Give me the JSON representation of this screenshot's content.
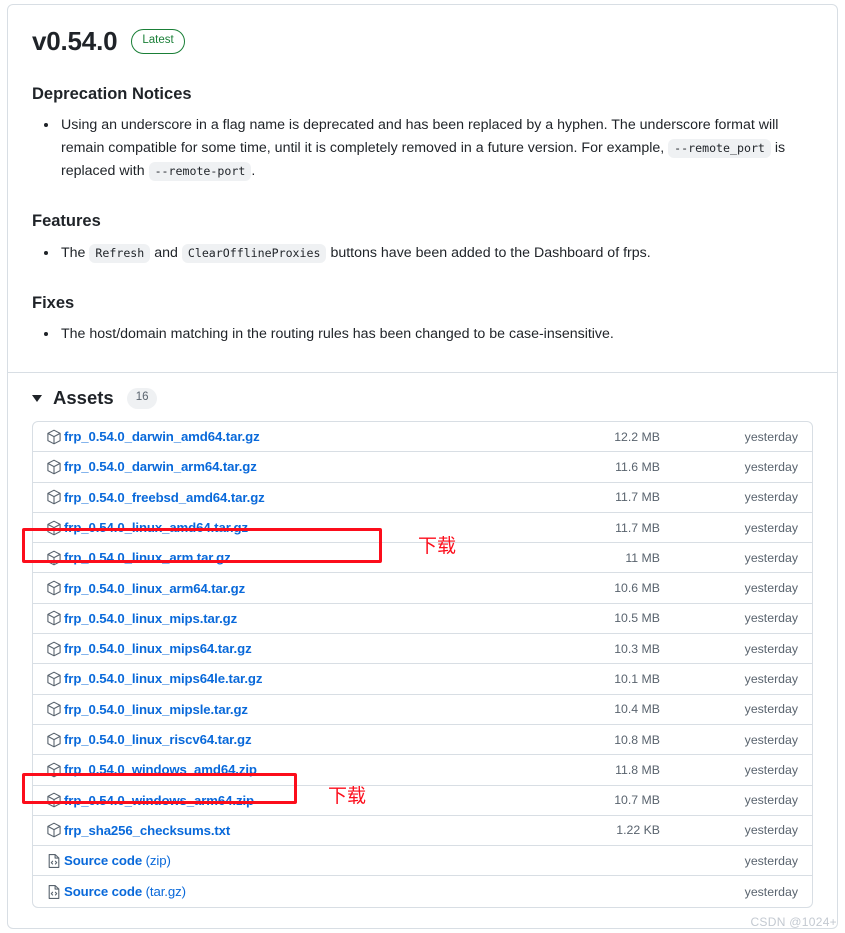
{
  "release": {
    "version": "v0.54.0",
    "latest_badge": "Latest"
  },
  "sections": {
    "deprecation": {
      "heading": "Deprecation Notices",
      "item_part1": "Using an underscore in a flag name is deprecated and has been replaced by a hyphen. The underscore format will remain compatible for some time, until it is completely removed in a future version. For example,",
      "code1": "--remote_port",
      "item_part2": "is replaced with",
      "code2": "--remote-port",
      "item_part3": "."
    },
    "features": {
      "heading": "Features",
      "item_part1": "The",
      "code1": "Refresh",
      "item_part2": "and",
      "code2": "ClearOfflineProxies",
      "item_part3": "buttons have been added to the Dashboard of frps."
    },
    "fixes": {
      "heading": "Fixes",
      "item": "The host/domain matching in the routing rules has been changed to be case-insensitive."
    }
  },
  "assets": {
    "label": "Assets",
    "count": "16",
    "rows": [
      {
        "name": "frp_0.54.0_darwin_amd64.tar.gz",
        "icon": "package-icon",
        "size": "12.2 MB",
        "date": "yesterday"
      },
      {
        "name": "frp_0.54.0_darwin_arm64.tar.gz",
        "icon": "package-icon",
        "size": "11.6 MB",
        "date": "yesterday"
      },
      {
        "name": "frp_0.54.0_freebsd_amd64.tar.gz",
        "icon": "package-icon",
        "size": "11.7 MB",
        "date": "yesterday"
      },
      {
        "name": "frp_0.54.0_linux_amd64.tar.gz",
        "icon": "package-icon",
        "size": "11.7 MB",
        "date": "yesterday"
      },
      {
        "name": "frp_0.54.0_linux_arm.tar.gz",
        "icon": "package-icon",
        "size": "11 MB",
        "date": "yesterday"
      },
      {
        "name": "frp_0.54.0_linux_arm64.tar.gz",
        "icon": "package-icon",
        "size": "10.6 MB",
        "date": "yesterday"
      },
      {
        "name": "frp_0.54.0_linux_mips.tar.gz",
        "icon": "package-icon",
        "size": "10.5 MB",
        "date": "yesterday"
      },
      {
        "name": "frp_0.54.0_linux_mips64.tar.gz",
        "icon": "package-icon",
        "size": "10.3 MB",
        "date": "yesterday"
      },
      {
        "name": "frp_0.54.0_linux_mips64le.tar.gz",
        "icon": "package-icon",
        "size": "10.1 MB",
        "date": "yesterday"
      },
      {
        "name": "frp_0.54.0_linux_mipsle.tar.gz",
        "icon": "package-icon",
        "size": "10.4 MB",
        "date": "yesterday"
      },
      {
        "name": "frp_0.54.0_linux_riscv64.tar.gz",
        "icon": "package-icon",
        "size": "10.8 MB",
        "date": "yesterday"
      },
      {
        "name": "frp_0.54.0_windows_amd64.zip",
        "icon": "package-icon",
        "size": "11.8 MB",
        "date": "yesterday"
      },
      {
        "name": "frp_0.54.0_windows_arm64.zip",
        "icon": "package-icon",
        "size": "10.7 MB",
        "date": "yesterday"
      },
      {
        "name": "frp_sha256_checksums.txt",
        "icon": "package-icon",
        "size": "1.22 KB",
        "date": "yesterday"
      },
      {
        "name": "Source code (zip)",
        "icon": "file-code-icon",
        "size": "",
        "date": "yesterday"
      },
      {
        "name": "Source code (tar.gz)",
        "icon": "file-code-icon",
        "size": "",
        "date": "yesterday"
      }
    ]
  },
  "annotations": {
    "download_label_1": "下载",
    "download_label_2": "下载",
    "highlight_color": "#fc0d1b"
  },
  "watermark": "CSDN @1024+"
}
